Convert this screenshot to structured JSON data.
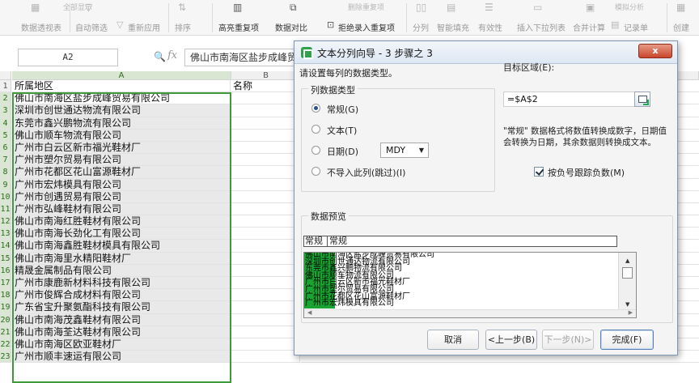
{
  "ribbon": {
    "tiny_top": [
      "全部显示",
      "删除重复项",
      "模拟分析"
    ],
    "buttons": [
      {
        "label": "数据透视表",
        "icon": "pivot-table-icon",
        "active": false
      },
      {
        "label": "自动筛选",
        "icon": "filter-icon",
        "active": false
      },
      {
        "label": "重新应用",
        "icon": "reapply-icon",
        "active": false
      },
      {
        "label": "排序",
        "icon": "sort-icon",
        "active": false
      },
      {
        "label": "高亮重复项",
        "icon": "highlight-duplicates-icon",
        "active": true
      },
      {
        "label": "数据对比",
        "icon": "data-compare-icon",
        "active": true
      },
      {
        "label": "拒绝录入重复项",
        "icon": "reject-duplicates-icon",
        "active": true
      },
      {
        "label": "分列",
        "icon": "split-columns-icon",
        "active": false
      },
      {
        "label": "智能填充",
        "icon": "smart-fill-icon",
        "active": false
      },
      {
        "label": "有效性",
        "icon": "validity-icon",
        "active": false
      },
      {
        "label": "插入下拉列表",
        "icon": "insert-dropdown-icon",
        "active": false
      },
      {
        "label": "合并计算",
        "icon": "consolidate-icon",
        "active": false
      },
      {
        "label": "记录单",
        "icon": "record-form-icon",
        "active": false
      },
      {
        "label": "创建",
        "icon": "create-group-icon",
        "active": false
      }
    ]
  },
  "formula_bar": {
    "cell_ref": "A2",
    "fx": "fx",
    "zoom_icon": "🔍",
    "value": "佛山市南海区盐步成峰贸易有限公司"
  },
  "grid": {
    "columns": [
      "A",
      "B"
    ],
    "rows": [
      {
        "n": "1",
        "a": "所属地区",
        "b": "名称"
      },
      {
        "n": "2",
        "a": "佛山市南海区盐步成峰贸易有限公司",
        "b": ""
      },
      {
        "n": "3",
        "a": "深圳市创世通达物流有限公司",
        "b": ""
      },
      {
        "n": "4",
        "a": "东莞市鑫兴鹏物流有限公司",
        "b": ""
      },
      {
        "n": "5",
        "a": "佛山市顺车物流有限公司",
        "b": ""
      },
      {
        "n": "6",
        "a": "广州市白云区新市福光鞋材厂",
        "b": ""
      },
      {
        "n": "7",
        "a": "广州市塑尔贸易有限公司",
        "b": ""
      },
      {
        "n": "8",
        "a": "广州市花都区花山富源鞋材厂",
        "b": ""
      },
      {
        "n": "9",
        "a": "广州市宏炜模具有限公司",
        "b": ""
      },
      {
        "n": "10",
        "a": "广州市创遇贸易有限公司",
        "b": ""
      },
      {
        "n": "11",
        "a": "广州市弘峰鞋材有限公司",
        "b": ""
      },
      {
        "n": "12",
        "a": "佛山市南海红胜鞋材有限公司",
        "b": ""
      },
      {
        "n": "13",
        "a": "佛山市南海长劲化工有限公司",
        "b": ""
      },
      {
        "n": "14",
        "a": "佛山市南海鑫胜鞋材模具有限公司",
        "b": ""
      },
      {
        "n": "15",
        "a": "佛山市南海里水精阳鞋材厂",
        "b": ""
      },
      {
        "n": "16",
        "a": "精晟金属制品有限公司",
        "b": ""
      },
      {
        "n": "17",
        "a": "广州市康鹿新材料科技有限公司",
        "b": ""
      },
      {
        "n": "18",
        "a": "广州市俊辉合成材料有限公司",
        "b": ""
      },
      {
        "n": "19",
        "a": "广东省宝升聚氨酯科技有限公司",
        "b": ""
      },
      {
        "n": "20",
        "a": "佛山市南海茂鑫鞋材有限公司",
        "b": ""
      },
      {
        "n": "21",
        "a": "佛山市南海荃达鞋材有限公司",
        "b": ""
      },
      {
        "n": "22",
        "a": "佛山市南海区欧亚鞋材厂",
        "b": ""
      },
      {
        "n": "23",
        "a": "广州市顺丰速运有限公司",
        "b": ""
      }
    ]
  },
  "dialog": {
    "title": "文本分列向导 - 3 步骤之 3",
    "close_label": "x",
    "prompt": "请设置每列的数据类型。",
    "column_type_group": "列数据类型",
    "radio_general": "常规(G)",
    "radio_text": "文本(T)",
    "radio_date": "日期(D)",
    "date_format": "MDY",
    "radio_skip": "不导入此列(跳过)(I)",
    "dest_label": "目标区域(E):",
    "dest_value": "=$A$2",
    "info": "\"常规\" 数据格式将数值转换成数字，日期值会转换为日期，其余数据则转换成文本。",
    "neg_checkbox": "按负号跟踪负数(M)",
    "preview_group": "数据预览",
    "preview_headers": [
      "常规",
      "常规"
    ],
    "preview_lines": [
      "佛山市南海区盐步成峰贸易有限公司",
      "深圳市创世通达物流有限公司",
      "东莞市鑫兴鹏物流有限公司",
      "佛山市顺车物流有限公司",
      "广州市白云区新市福光鞋材厂",
      "广州市塑尔贸易有限公司",
      "广州市花都区花山富源鞋材厂",
      "广州市宏炜模具有限公司"
    ],
    "btn_cancel": "取消",
    "btn_back": "<上一步(B)",
    "btn_next": "下一步(N)>",
    "btn_finish": "完成(F)"
  },
  "colors": {
    "selection_border": "#3f9a3a",
    "preview_highlight": "#19a532",
    "header_selected": "#d9e6d2"
  }
}
